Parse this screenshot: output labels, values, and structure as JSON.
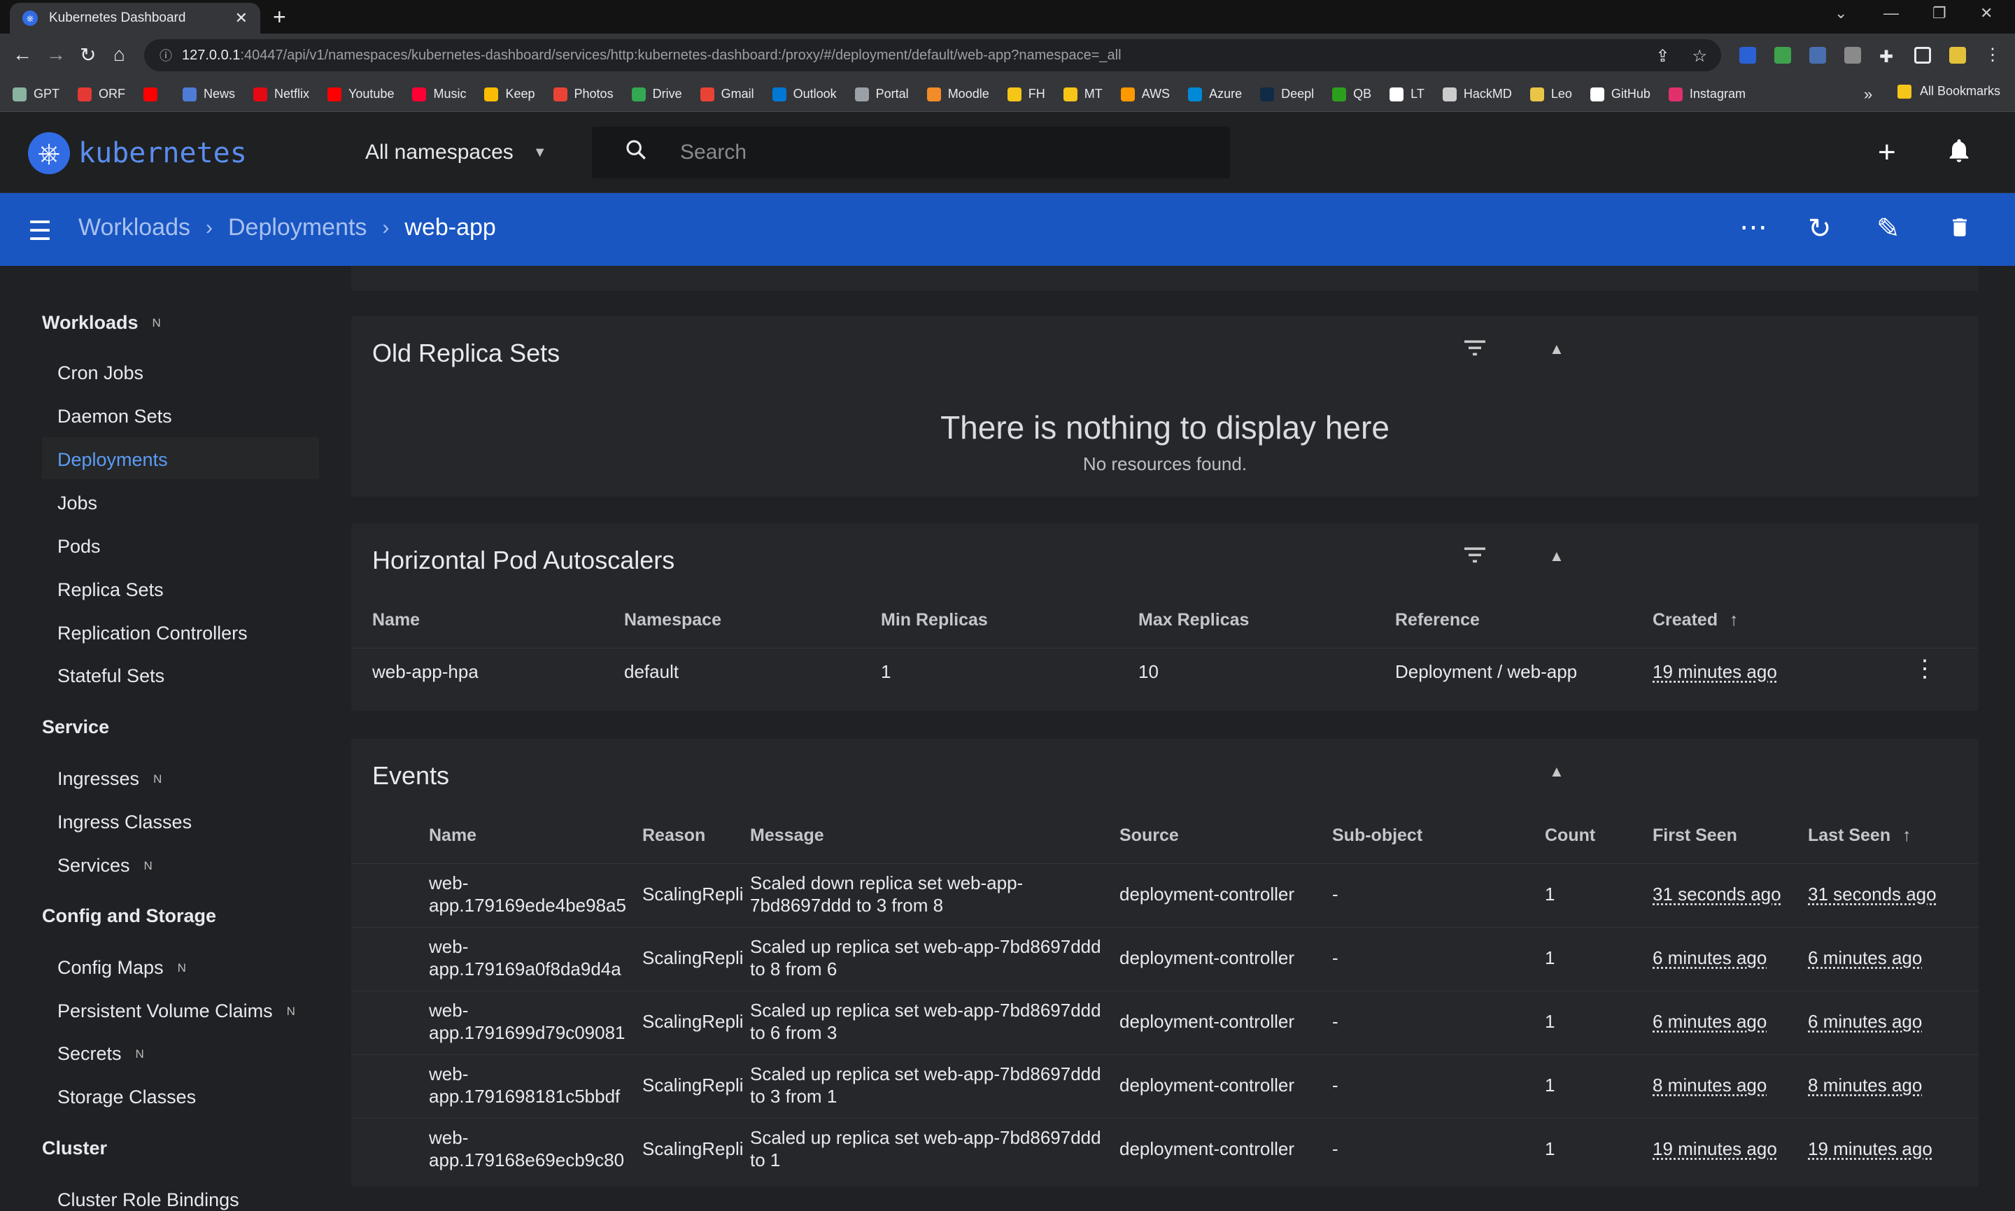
{
  "browser": {
    "tab_title": "Kubernetes Dashboard",
    "url_host": "127.0.0.1",
    "url_rest": ":40447/api/v1/namespaces/kubernetes-dashboard/services/http:kubernetes-dashboard:/proxy/#/deployment/default/web-app?namespace=_all",
    "bookmarks": [
      "GPT",
      "ORF",
      "",
      "News",
      "Netflix",
      "Youtube",
      "Music",
      "Keep",
      "Photos",
      "Drive",
      "Gmail",
      "Outlook",
      "Portal",
      "Moodle",
      "FH",
      "MT",
      "AWS",
      "Azure",
      "Deepl",
      "QB",
      "LT",
      "HackMD",
      "Leo",
      "GitHub",
      "Instagram"
    ],
    "bookmark_colors": [
      "#8ab4a0",
      "#e53935",
      "#ff0000",
      "#4f7cd6",
      "#e50914",
      "#ff0000",
      "#ff0033",
      "#fbbc04",
      "#ea4335",
      "#34a853",
      "#ea4335",
      "#0078d4",
      "#9aa0a6",
      "#f28c28",
      "#f5c518",
      "#f5c518",
      "#ff9900",
      "#0089d6",
      "#0f2b46",
      "#2ca01c",
      "#ffffff",
      "#cccccc",
      "#e8c547",
      "#ffffff",
      "#e1306c"
    ],
    "more_bookmarks": "»",
    "all_bookmarks": "All Bookmarks"
  },
  "app": {
    "logo_text": "kubernetes",
    "namespace_selector": "All namespaces",
    "search_placeholder": "Search"
  },
  "toolbar": {
    "breadcrumbs": [
      "Workloads",
      "Deployments",
      "web-app"
    ]
  },
  "sidebar": {
    "workloads": {
      "label": "Workloads",
      "badge": "N"
    },
    "workload_items": [
      "Cron Jobs",
      "Daemon Sets",
      "Deployments",
      "Jobs",
      "Pods",
      "Replica Sets",
      "Replication Controllers",
      "Stateful Sets"
    ],
    "service": "Service",
    "service_items": [
      {
        "label": "Ingresses",
        "badge": "N"
      },
      {
        "label": "Ingress Classes",
        "badge": ""
      },
      {
        "label": "Services",
        "badge": "N"
      }
    ],
    "config": "Config and Storage",
    "config_items": [
      {
        "label": "Config Maps",
        "badge": "N"
      },
      {
        "label": "Persistent Volume Claims",
        "badge": "N"
      },
      {
        "label": "Secrets",
        "badge": "N"
      },
      {
        "label": "Storage Classes",
        "badge": ""
      }
    ],
    "cluster": "Cluster",
    "cluster_items": [
      "Cluster Role Bindings"
    ]
  },
  "old_replica_sets": {
    "title": "Old Replica Sets",
    "empty_title": "There is nothing to display here",
    "empty_subtitle": "No resources found."
  },
  "hpa": {
    "title": "Horizontal Pod Autoscalers",
    "columns": [
      "Name",
      "Namespace",
      "Min Replicas",
      "Max Replicas",
      "Reference",
      "Created"
    ],
    "row": {
      "name": "web-app-hpa",
      "namespace": "default",
      "min": "1",
      "max": "10",
      "reference": "Deployment / web-app",
      "created": "19 minutes ago"
    }
  },
  "events": {
    "title": "Events",
    "columns": [
      "Name",
      "Reason",
      "Message",
      "Source",
      "Sub-object",
      "Count",
      "First Seen",
      "Last Seen"
    ],
    "rows": [
      {
        "name1": "web-",
        "name2": "app.179169ede4be98a5",
        "reason": "ScalingRepli",
        "msg1": "Scaled down replica set web-app-",
        "msg2": "7bd8697ddd to 3 from 8",
        "source": "deployment-controller",
        "sub": "-",
        "count": "1",
        "first": "31 seconds ago",
        "last": "31 seconds ago"
      },
      {
        "name1": "web-",
        "name2": "app.179169a0f8da9d4a",
        "reason": "ScalingRepli",
        "msg1": "Scaled up replica set web-app-7bd8697ddd",
        "msg2": "to 8 from 6",
        "source": "deployment-controller",
        "sub": "-",
        "count": "1",
        "first": "6 minutes ago",
        "last": "6 minutes ago"
      },
      {
        "name1": "web-",
        "name2": "app.1791699d79c09081",
        "reason": "ScalingRepli",
        "msg1": "Scaled up replica set web-app-7bd8697ddd",
        "msg2": "to 6 from 3",
        "source": "deployment-controller",
        "sub": "-",
        "count": "1",
        "first": "6 minutes ago",
        "last": "6 minutes ago"
      },
      {
        "name1": "web-",
        "name2": "app.1791698181c5bbdf",
        "reason": "ScalingRepli",
        "msg1": "Scaled up replica set web-app-7bd8697ddd",
        "msg2": "to 3 from 1",
        "source": "deployment-controller",
        "sub": "-",
        "count": "1",
        "first": "8 minutes ago",
        "last": "8 minutes ago"
      },
      {
        "name1": "web-",
        "name2": "app.179168e69ecb9c80",
        "reason": "ScalingRepli",
        "msg1": "Scaled up replica set web-app-7bd8697ddd",
        "msg2": "to 1",
        "source": "deployment-controller",
        "sub": "-",
        "count": "1",
        "first": "19 minutes ago",
        "last": "19 minutes ago"
      }
    ]
  }
}
